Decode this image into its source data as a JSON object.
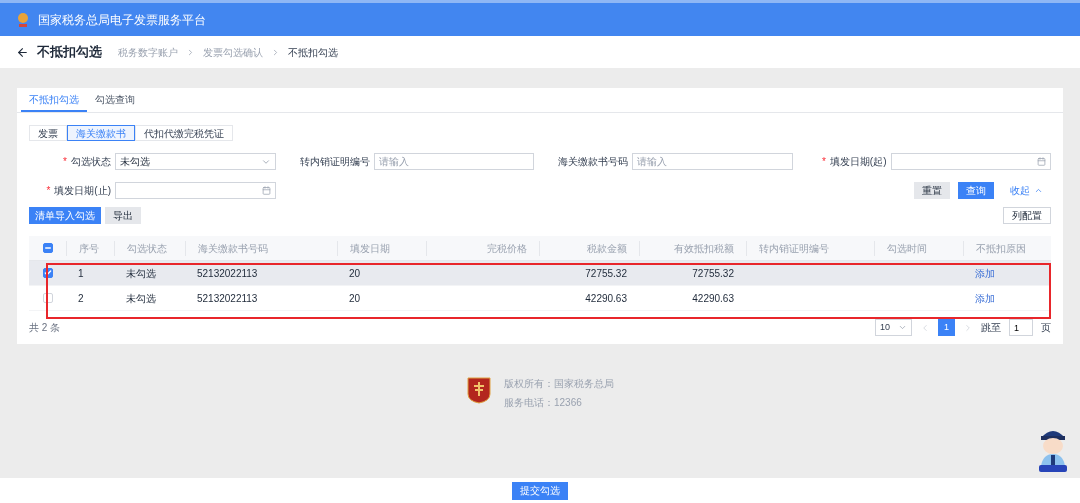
{
  "header": {
    "title": "国家税务总局电子发票服务平台"
  },
  "page": {
    "title": "不抵扣勾选",
    "breadcrumb": [
      "税务数字账户",
      "发票勾选确认",
      "不抵扣勾选"
    ]
  },
  "tabs": [
    {
      "label": "不抵扣勾选",
      "selected": true
    },
    {
      "label": "勾选查询",
      "selected": false
    }
  ],
  "doc_types": [
    {
      "label": "发票",
      "selected": false
    },
    {
      "label": "海关缴款书",
      "selected": true
    },
    {
      "label": "代扣代缴完税凭证",
      "selected": false
    }
  ],
  "required_mark": "*",
  "filters": [
    {
      "kind": "select",
      "label": "勾选状态",
      "required": true,
      "value": "未勾选"
    },
    {
      "kind": "input",
      "label": "转内销证明编号",
      "required": false,
      "placeholder": "请输入"
    },
    {
      "kind": "input",
      "label": "海关缴款书号码",
      "required": false,
      "placeholder": "请输入"
    },
    {
      "kind": "date",
      "label": "填发日期(起)",
      "required": true
    },
    {
      "kind": "date",
      "label": "填发日期(止)",
      "required": true
    }
  ],
  "actions": {
    "reset": "重置",
    "query": "查询",
    "collapse": "收起"
  },
  "toolbar": {
    "import": "清单导入勾选",
    "export": "导出",
    "columns": "列配置"
  },
  "table": {
    "header_indeterminate": true,
    "columns": [
      {
        "label": "序号",
        "kind": "text"
      },
      {
        "label": "勾选状态",
        "kind": "text"
      },
      {
        "label": "海关缴款书号码",
        "kind": "text"
      },
      {
        "label": "填发日期",
        "kind": "text"
      },
      {
        "label": "完税价格",
        "kind": "amount"
      },
      {
        "label": "税款金额",
        "kind": "amount"
      },
      {
        "label": "有效抵扣税额",
        "kind": "amount"
      },
      {
        "label": "转内销证明编号",
        "kind": "text"
      },
      {
        "label": "勾选时间",
        "kind": "text"
      },
      {
        "label": "不抵扣原因",
        "kind": "text"
      }
    ],
    "rows": [
      {
        "selected": true,
        "index": "1",
        "status": "未勾选",
        "number": "52132022113",
        "date": "20",
        "tax_amount": "72755.32",
        "deductible": "72755.32",
        "action": "添加"
      },
      {
        "selected": false,
        "index": "2",
        "status": "未勾选",
        "number": "52132022113",
        "date": "20",
        "tax_amount": "42290.63",
        "deductible": "42290.63",
        "action": "添加"
      }
    ],
    "highlighted": true
  },
  "total": "共 2 条",
  "pagination": {
    "page_size": "10",
    "pages": [
      {
        "label": "1",
        "selected": true
      }
    ],
    "jump_label": "跳至",
    "jump_value": "1",
    "page_unit": "页"
  },
  "footer": {
    "lines": [
      "版权所有：国家税务总局",
      "服务电话：12366"
    ]
  },
  "submit": "提交勾选"
}
